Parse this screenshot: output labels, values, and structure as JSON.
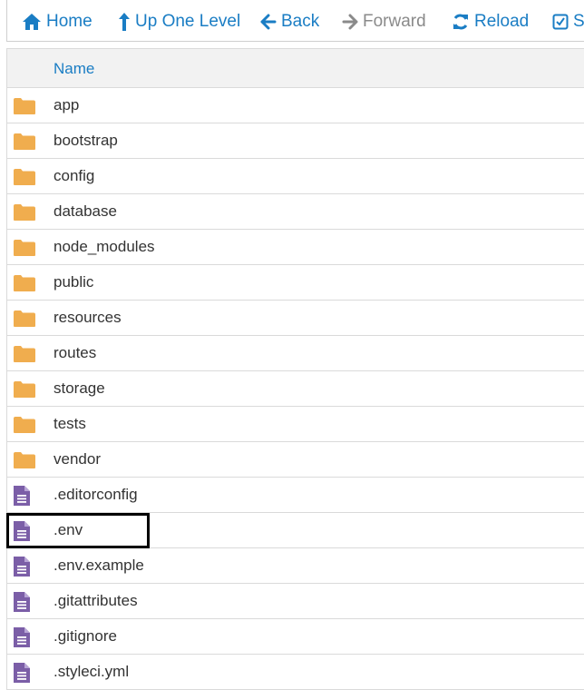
{
  "toolbar": {
    "home": {
      "label": "Home",
      "icon": "home-icon"
    },
    "up": {
      "label": "Up One Level",
      "icon": "up-arrow-icon"
    },
    "back": {
      "label": "Back",
      "icon": "left-arrow-icon"
    },
    "forward": {
      "label": "Forward",
      "icon": "right-arrow-icon"
    },
    "reload": {
      "label": "Reload",
      "icon": "refresh-icon"
    },
    "select": {
      "label": "Se",
      "icon": "checkbox-icon"
    }
  },
  "table": {
    "column_name": "Name"
  },
  "items": [
    {
      "name": "app",
      "type": "folder"
    },
    {
      "name": "bootstrap",
      "type": "folder"
    },
    {
      "name": "config",
      "type": "folder"
    },
    {
      "name": "database",
      "type": "folder"
    },
    {
      "name": "node_modules",
      "type": "folder"
    },
    {
      "name": "public",
      "type": "folder"
    },
    {
      "name": "resources",
      "type": "folder"
    },
    {
      "name": "routes",
      "type": "folder"
    },
    {
      "name": "storage",
      "type": "folder"
    },
    {
      "name": "tests",
      "type": "folder"
    },
    {
      "name": "vendor",
      "type": "folder"
    },
    {
      "name": ".editorconfig",
      "type": "file"
    },
    {
      "name": ".env",
      "type": "file"
    },
    {
      "name": ".env.example",
      "type": "file"
    },
    {
      "name": ".gitattributes",
      "type": "file"
    },
    {
      "name": ".gitignore",
      "type": "file"
    },
    {
      "name": ".styleci.yml",
      "type": "file"
    }
  ],
  "colors": {
    "accent": "#1a7dc4",
    "folder": "#f0ad4e",
    "file": "#7b5ea7"
  }
}
